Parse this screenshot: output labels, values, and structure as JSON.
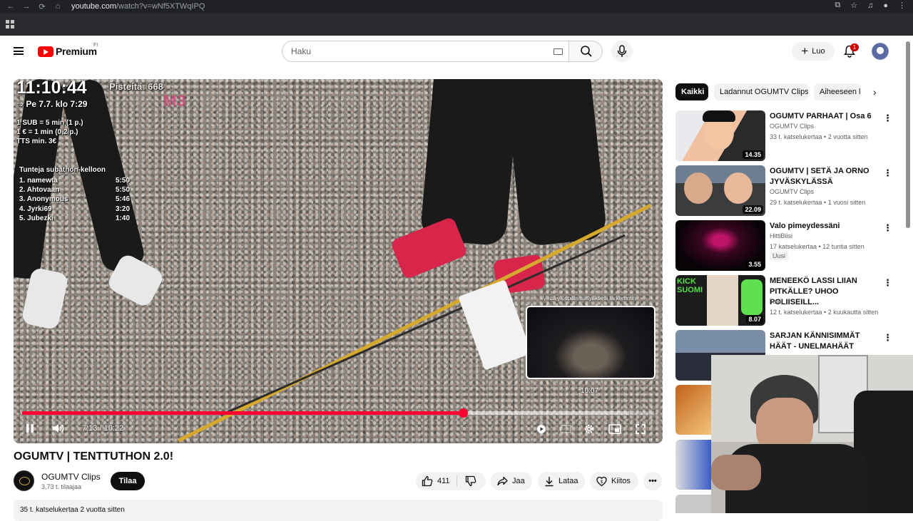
{
  "browser": {
    "url_host": "youtube.com",
    "url_path": "/watch?v=wNf5XTWqIPQ"
  },
  "header": {
    "brand": "Premium",
    "region": "FI",
    "search_placeholder": "Haku",
    "create_label": "Luo",
    "notification_count": "1"
  },
  "player": {
    "overlay": {
      "clock": "11:10:44",
      "points": "Pisteitä: 668",
      "logo": "M3",
      "date": "⇨ Pe 7.7. klo 7:29",
      "rules": "1 SUB = 5 min (1 p.)\n1 € = 1 min (0,2 p.)\nTTS min. 3€",
      "top_title": "Tunteja subathon-kelloon",
      "top_list": [
        {
          "name": "1. namewta",
          "time": "5:50"
        },
        {
          "name": "2. Ahtovaan",
          "time": "5:50"
        },
        {
          "name": "3. Anonymous",
          "time": "5:46"
        },
        {
          "name": "4. Jyrki69",
          "time": "3:20"
        },
        {
          "name": "5. Jubezki",
          "time": "1:40"
        }
      ]
    },
    "preview_hint": "Vedä ylöspäin siirtyäksesi tarkemmin",
    "preview_time": "10:07",
    "current_time": "7:13",
    "duration": "10:22",
    "time_display": "7:13 / 10:22",
    "progress": 0.697,
    "buffered": 0.96
  },
  "video": {
    "title": "OGUMTV | TENTTUTHON 2.0!",
    "channel": "OGUMTV Clips",
    "subscribers": "3,73 t. tilaajaa",
    "subscribe_label": "Tilaa",
    "likes": "411",
    "share_label": "Jaa",
    "download_label": "Lataa",
    "thanks_label": "Kiitos",
    "description_meta": "35 t. katselukertaa  2 vuotta sitten"
  },
  "sidebar": {
    "chips": [
      "Kaikki",
      "Ladannut OGUMTV Clips",
      "Aiheeseen liittyvät"
    ],
    "recommendations": [
      {
        "title": "OGUMTV PARHAAT | Osa 6",
        "channel": "OGUMTV Clips",
        "meta": "33 t. katselukertaa • 2 vuotta sitten",
        "duration": "14.35"
      },
      {
        "title": "OGUMTV | SETÄ JA ORNO JYVÄSKYLÄSSÄ",
        "channel": "OGUMTV Clips",
        "meta": "29 t. katselukertaa • 1 vuosi sitten",
        "duration": "22.09"
      },
      {
        "title": "Valo pimeydessäni",
        "channel": "HittiBiisi",
        "meta": "17 katselukertaa • 12 tuntia sitten",
        "duration": "3.55",
        "badge": "Uusi"
      },
      {
        "title": "MENEEKÖ LASSI LIIAN PITKÄLLE? UHOO POLIISEILL...",
        "channel": "Texi",
        "meta": "12 t. katselukertaa • 2 kuukautta sitten",
        "duration": "8.07"
      },
      {
        "title": "SARJAN KÄNNISIMMÄT HÄÄT - UNELMAHÄÄT",
        "channel": "",
        "meta": "",
        "duration": ""
      }
    ]
  },
  "colors": {
    "accent": "#ff0033",
    "brand_red": "#ff0000",
    "chip_active": "#0f0f0f"
  }
}
